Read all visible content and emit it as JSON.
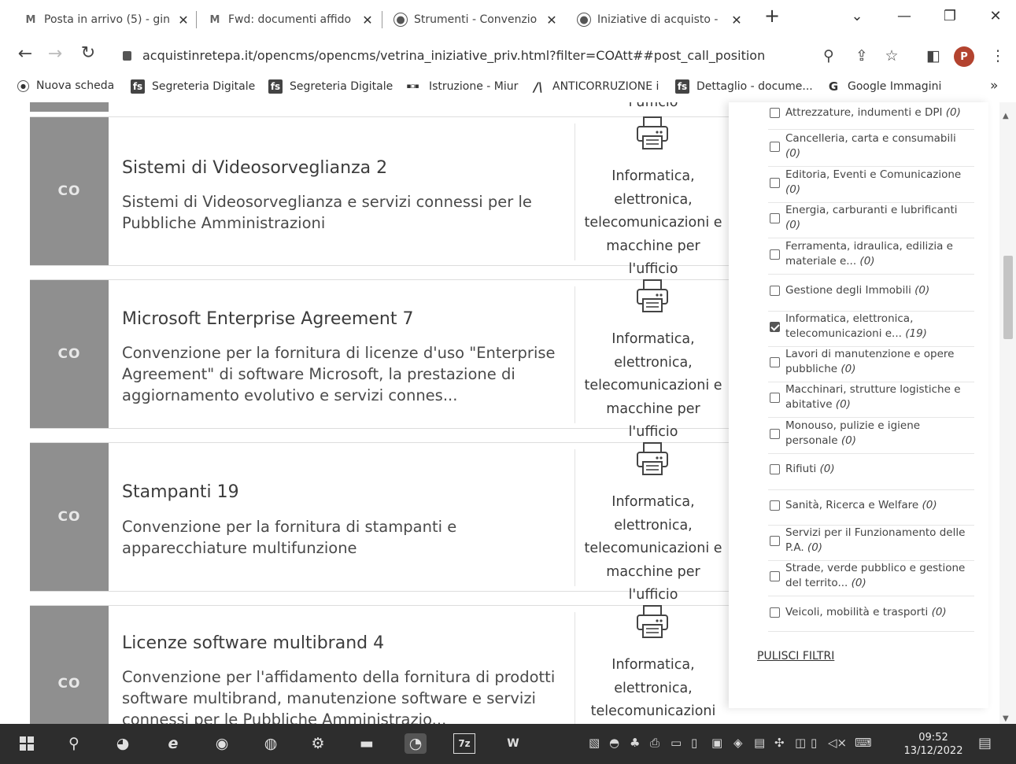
{
  "browser": {
    "tabs": [
      {
        "icon": "gmail-icon",
        "label": "Posta in arrivo (5) - gin"
      },
      {
        "icon": "gmail-icon",
        "label": "Fwd: documenti affido"
      },
      {
        "icon": "globe-icon",
        "label": "Strumenti - Convenzio"
      },
      {
        "icon": "globe-icon",
        "label": "Iniziative di acquisto -"
      }
    ],
    "new_tab": "+",
    "url": "acquistinretepa.it/opencms/opencms/vetrina_iniziative_priv.html?filter=COAtt##post_call_position",
    "avatar_letter": "P",
    "bookmarks": [
      {
        "icon": "globe-icon",
        "label": "Nuova scheda"
      },
      {
        "icon": "fs-icon",
        "label": "Segreteria Digitale"
      },
      {
        "icon": "fs-icon",
        "label": "Segreteria Digitale"
      },
      {
        "icon": "miur-icon",
        "label": "Istruzione - Miur"
      },
      {
        "icon": "anac-icon",
        "label": "ANTICORRUZIONE i"
      },
      {
        "icon": "fs-icon",
        "label": "Dettaglio - docume..."
      },
      {
        "icon": "google-icon",
        "label": "Google Immagini"
      }
    ],
    "bookmarks_more": "»"
  },
  "cards": [
    {
      "badge": "CO",
      "title": "Sistemi di Videosorveglianza 2",
      "description": "Sistemi di Videosorveglianza e servizi connessi per le Pubbliche Amministrazioni",
      "category": "Informatica, elettronica, telecomunicazioni e macchine per l'ufficio"
    },
    {
      "badge": "CO",
      "title": "Microsoft Enterprise Agreement 7",
      "description": "Convenzione per la fornitura di licenze d'uso \"Enterprise Agreement\" di software Microsoft, la prestazione di aggiornamento evolutivo e servizi connes...",
      "category": "Informatica, elettronica, telecomunicazioni e macchine per l'ufficio"
    },
    {
      "badge": "CO",
      "title": "Stampanti 19",
      "description": "Convenzione per la fornitura di stampanti e apparecchiature multifunzione",
      "category": "Informatica, elettronica, telecomunicazioni e macchine per l'ufficio"
    },
    {
      "badge": "CO",
      "title": "Licenze software multibrand 4",
      "description": "Convenzione per l'affidamento della fornitura di prodotti software multibrand, manutenzione software e servizi connessi per le Pubbliche Amministrazio...",
      "category": "Informatica, elettronica, telecomunicazioni"
    }
  ],
  "top_fragment": "l'ufficio",
  "filters": {
    "items": [
      {
        "label": "Attrezzature, indumenti e DPI",
        "count": "(0)",
        "checked": false
      },
      {
        "label": "Cancelleria, carta e consumabili",
        "count": "(0)",
        "checked": false
      },
      {
        "label": "Editoria, Eventi e Comunicazione",
        "count": "(0)",
        "checked": false
      },
      {
        "label": "Energia, carburanti e lubrificanti",
        "count": "(0)",
        "checked": false
      },
      {
        "label": "Ferramenta, idraulica, edilizia e materiale e...",
        "count": "(0)",
        "checked": false
      },
      {
        "label": "Gestione degli Immobili",
        "count": "(0)",
        "checked": false
      },
      {
        "label": "Informatica, elettronica, telecomunicazioni e...",
        "count": "(19)",
        "checked": true
      },
      {
        "label": "Lavori di manutenzione e opere pubbliche",
        "count": "(0)",
        "checked": false
      },
      {
        "label": "Macchinari, strutture logistiche e abitative",
        "count": "(0)",
        "checked": false
      },
      {
        "label": "Monouso, pulizie e igiene personale",
        "count": "(0)",
        "checked": false
      },
      {
        "label": "Rifiuti",
        "count": "(0)",
        "checked": false
      },
      {
        "label": "Sanità, Ricerca e Welfare",
        "count": "(0)",
        "checked": false
      },
      {
        "label": "Servizi per il Funzionamento delle P.A.",
        "count": "(0)",
        "checked": false
      },
      {
        "label": "Strade, verde pubblico e gestione del territo...",
        "count": "(0)",
        "checked": false
      },
      {
        "label": "Veicoli, mobilità e trasporti",
        "count": "(0)",
        "checked": false
      }
    ],
    "clear_label": "PULISCI FILTRI"
  },
  "taskbar": {
    "time": "09:52",
    "date": "13/12/2022"
  },
  "colors": {
    "badge_band": "#8f8f8f",
    "avatar": "#b3432f",
    "taskbar": "#2d2d2d"
  }
}
